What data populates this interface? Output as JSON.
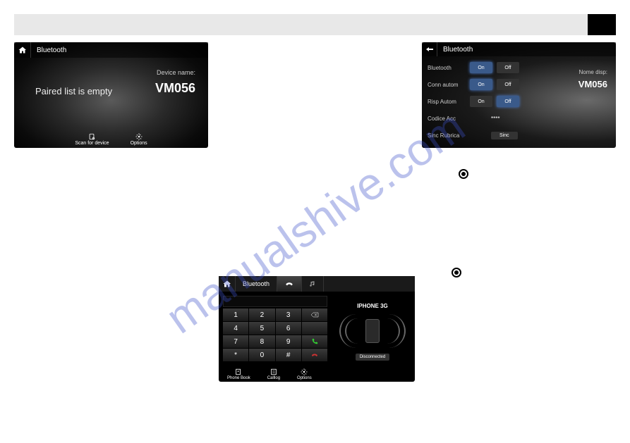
{
  "watermark": "manualshive.com",
  "screen1": {
    "title": "Bluetooth",
    "device_label": "Device name:",
    "device_name": "VM056",
    "empty_msg": "Paired list is empty",
    "footer_scan": "Scan for device",
    "footer_options": "Options"
  },
  "screen2": {
    "title": "Bluetooth",
    "name_disp_label": "Nome disp:",
    "name_disp_value": "VM056",
    "rows": {
      "bluetooth": {
        "label": "Bluetooth",
        "on": "On",
        "off": "Off"
      },
      "conn": {
        "label": "Conn autom",
        "on": "On",
        "off": "Off"
      },
      "risp": {
        "label": "Risp Autom",
        "on": "On",
        "off": "Off"
      },
      "codice": {
        "label": "Codice Acc",
        "value": "****"
      },
      "sinc": {
        "label": "Sinc Rubrica",
        "btn": "Sinc"
      }
    }
  },
  "screen3": {
    "title": "Bluetooth",
    "device": "IPHONE 3G",
    "disconnect": "Disconnected",
    "keys": [
      "1",
      "2",
      "3",
      "4",
      "5",
      "6",
      "7",
      "8",
      "9",
      "*",
      "0",
      "#"
    ],
    "footer_phonebook": "Phone Book",
    "footer_calllog": "Calllog",
    "footer_options": "Options"
  }
}
